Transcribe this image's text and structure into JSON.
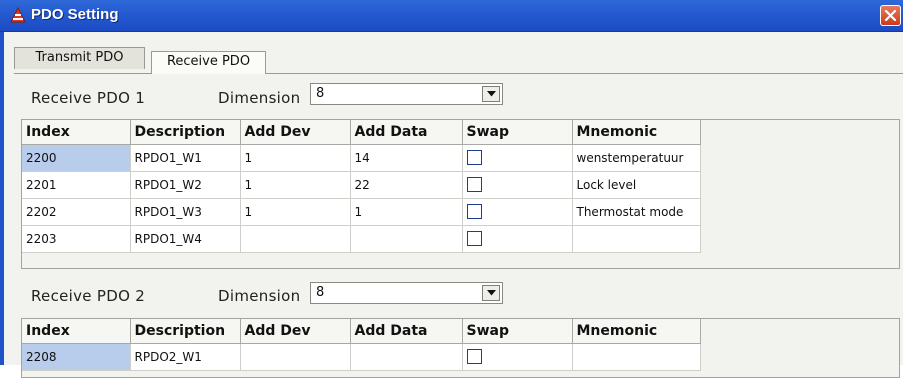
{
  "window": {
    "title": "PDO Setting"
  },
  "tabs": [
    {
      "label": "Transmit PDO",
      "active": false
    },
    {
      "label": "Receive PDO",
      "active": true
    }
  ],
  "groups": [
    {
      "label": "Receive PDO 1",
      "dimension_label": "Dimension",
      "dimension_value": "8",
      "columns": [
        "Index",
        "Description",
        "Add Dev",
        "Add Data",
        "Swap",
        "Mnemonic"
      ],
      "rows": [
        {
          "index": "2200",
          "description": "RPDO1_W1",
          "add_dev": "1",
          "add_data": "14",
          "swap": false,
          "mnemonic": "wenstemperatuur",
          "selected": true
        },
        {
          "index": "2201",
          "description": "RPDO1_W2",
          "add_dev": "1",
          "add_data": "22",
          "swap": false,
          "mnemonic": "Lock level",
          "selected": false
        },
        {
          "index": "2202",
          "description": "RPDO1_W3",
          "add_dev": "1",
          "add_data": "1",
          "swap": false,
          "mnemonic": "Thermostat mode",
          "selected": false
        },
        {
          "index": "2203",
          "description": "RPDO1_W4",
          "add_dev": "",
          "add_data": "",
          "swap": false,
          "mnemonic": "",
          "selected": false
        }
      ]
    },
    {
      "label": "Receive PDO 2",
      "dimension_label": "Dimension",
      "dimension_value": "8",
      "columns": [
        "Index",
        "Description",
        "Add Dev",
        "Add Data",
        "Swap",
        "Mnemonic"
      ],
      "rows": [
        {
          "index": "2208",
          "description": "RPDO2_W1",
          "add_dev": "",
          "add_data": "",
          "swap": false,
          "mnemonic": "",
          "selected": true
        }
      ]
    }
  ],
  "colors": {
    "titlebar": "#245edb",
    "selected_cell": "#b8cceb",
    "checkbox_border": "#1c3f8a"
  }
}
